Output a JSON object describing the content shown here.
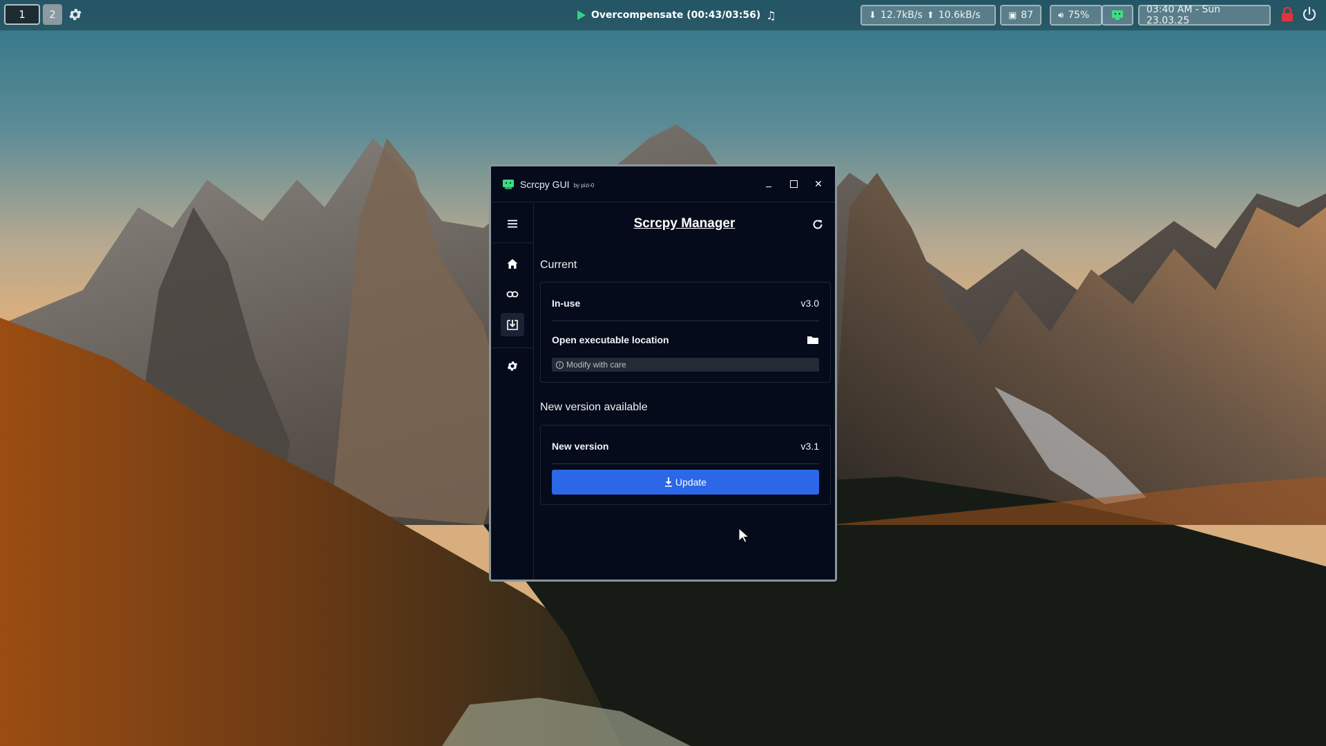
{
  "taskbar": {
    "workspaces": [
      {
        "label": "1"
      },
      {
        "label": "2"
      }
    ],
    "media": {
      "text": "Overcompensate (00:43/03:56)",
      "icon_play": "play-icon",
      "icon_note": "music-note-icon"
    },
    "network": {
      "down": "12.7kB/s",
      "up": "10.6kB/s"
    },
    "packages": {
      "count": "87"
    },
    "volume": {
      "level": "75%"
    },
    "clock": {
      "text": "03:40 AM - Sun 23.03.25"
    },
    "colors": {
      "play": "#35d07f",
      "lock": "#e0343c"
    }
  },
  "window": {
    "title": "Scrcpy GUI",
    "subtitle": "by pizi-0",
    "header_title": "Scrcpy Manager",
    "sections": {
      "current": {
        "title": "Current",
        "in_use_label": "In-use",
        "in_use_value": "v3.0",
        "open_location_label": "Open executable location",
        "hint": "Modify with care"
      },
      "new": {
        "title": "New version available",
        "new_version_label": "New version",
        "new_version_value": "v3.1",
        "update_label": "Update"
      }
    },
    "colors": {
      "background": "#050b1a",
      "accent": "#2b67e6"
    }
  }
}
